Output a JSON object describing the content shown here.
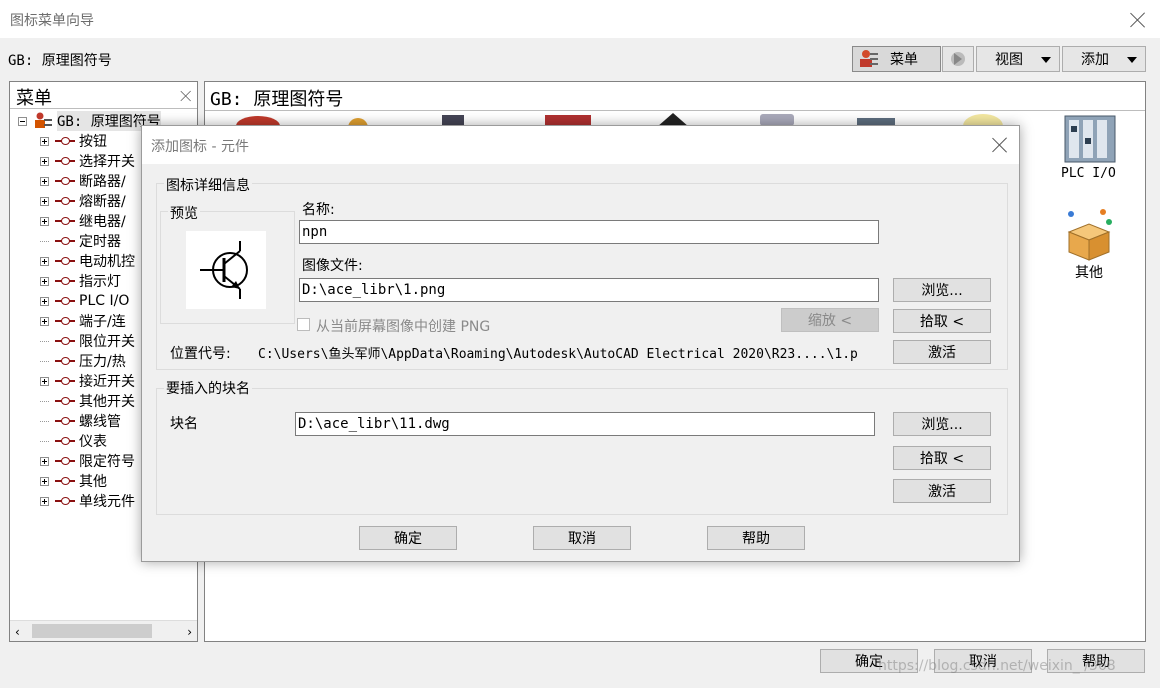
{
  "window": {
    "title": "图标菜单向导"
  },
  "header": {
    "subtitle": "GB: 原理图符号"
  },
  "toolbar": {
    "menu_label": "菜单",
    "view_label": "视图",
    "add_label": "添加"
  },
  "left_panel": {
    "title": "菜单",
    "root_label": "GB: 原理图符号",
    "items": [
      {
        "label": "按钮",
        "expandable": true
      },
      {
        "label": "选择开关",
        "expandable": true
      },
      {
        "label": "断路器/",
        "expandable": true
      },
      {
        "label": "熔断器/",
        "expandable": true
      },
      {
        "label": "继电器/",
        "expandable": true
      },
      {
        "label": "定时器",
        "expandable": false
      },
      {
        "label": "电动机控",
        "expandable": true
      },
      {
        "label": "指示灯",
        "expandable": true
      },
      {
        "label": "PLC I/O",
        "expandable": true
      },
      {
        "label": "端子/连",
        "expandable": true
      },
      {
        "label": "限位开关",
        "expandable": false
      },
      {
        "label": "压力/热",
        "expandable": false
      },
      {
        "label": "接近开关",
        "expandable": true
      },
      {
        "label": "其他开关",
        "expandable": false
      },
      {
        "label": "螺线管",
        "expandable": false
      },
      {
        "label": "仪表",
        "expandable": false
      },
      {
        "label": "限定符号",
        "expandable": true
      },
      {
        "label": "其他",
        "expandable": true
      },
      {
        "label": "单线元件",
        "expandable": true
      }
    ]
  },
  "right_panel": {
    "title": "GB: 原理图符号",
    "icons": {
      "plc_label": "PLC I/O",
      "other_label": "其他"
    }
  },
  "dialog": {
    "title": "添加图标 - 元件",
    "details_group": "图标详细信息",
    "preview_label": "预览",
    "name_label": "名称:",
    "name_value": "npn",
    "image_label": "图像文件:",
    "image_value": "D:\\ace_libr\\1.png",
    "create_png_label": "从当前屏幕图像中创建 PNG",
    "zoom_label": "缩放 <",
    "browse_label": "浏览...",
    "pick_label": "拾取 <",
    "activate_label": "激活",
    "location_label": "位置代号:",
    "location_value": "C:\\Users\\鱼头军师\\AppData\\Roaming\\Autodesk\\AutoCAD Electrical 2020\\R23....\\1.p",
    "block_group": "要插入的块名",
    "block_label": "块名",
    "block_value": "D:\\ace_libr\\11.dwg",
    "ok_label": "确定",
    "cancel_label": "取消",
    "help_label": "帮助"
  },
  "footer": {
    "ok_label": "确定",
    "cancel_label": "取消",
    "help_label": "帮助",
    "watermark": "https://blog.csdn.net/weixin_  /368"
  }
}
